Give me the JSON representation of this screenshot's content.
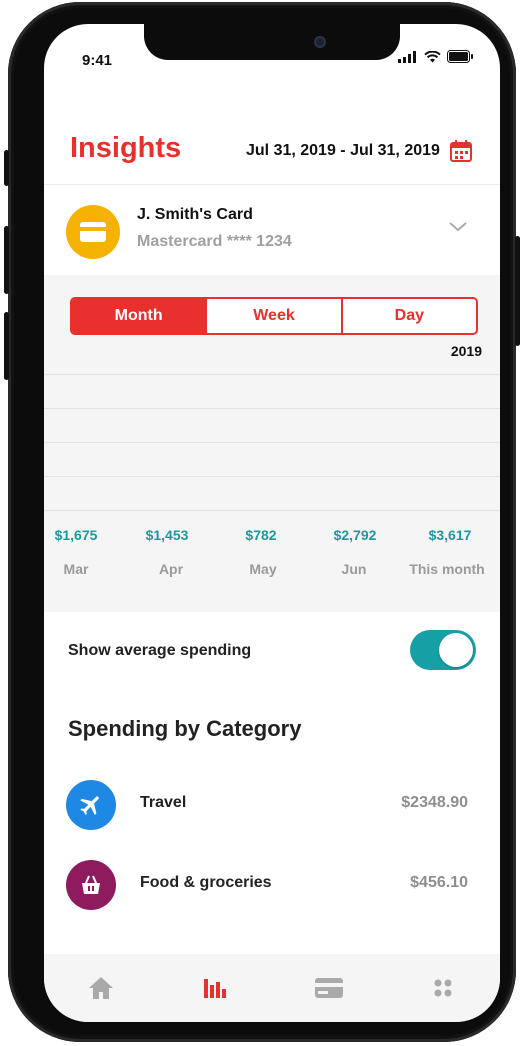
{
  "status_bar": {
    "time": "9:41"
  },
  "header": {
    "title": "Insights",
    "date_range": "Jul 31, 2019 - Jul 31, 2019",
    "calendar_icon": "calendar-icon"
  },
  "card": {
    "name": "J. Smith's Card",
    "subtitle": "Mastercard **** 1234",
    "icon": "credit-card-icon",
    "expand_icon": "chevron-down-icon"
  },
  "period_tabs": [
    {
      "label": "Month",
      "active": true
    },
    {
      "label": "Week",
      "active": false
    },
    {
      "label": "Day",
      "active": false
    }
  ],
  "chart": {
    "year": "2019",
    "columns": [
      {
        "amount": "$1,675",
        "label": "Mar"
      },
      {
        "amount": "$1,453",
        "label": "Apr"
      },
      {
        "amount": "$782",
        "label": "May"
      },
      {
        "amount": "$2,792",
        "label": "Jun"
      },
      {
        "amount": "$3,617",
        "label": "This month"
      }
    ]
  },
  "average_toggle": {
    "label": "Show average spending",
    "on": true
  },
  "categories": {
    "title": "Spending by Category",
    "items": [
      {
        "label": "Travel",
        "value": "$2348.90",
        "icon": "airplane-icon",
        "color": "#1e88e5"
      },
      {
        "label": "Food & groceries",
        "value": "$456.10",
        "icon": "shopping-basket-icon",
        "color": "#8e1b5e"
      }
    ]
  },
  "bottom_nav": [
    {
      "icon": "home-icon",
      "active": false
    },
    {
      "icon": "bar-chart-icon",
      "active": true
    },
    {
      "icon": "card-icon",
      "active": false
    },
    {
      "icon": "more-grid-icon",
      "active": false
    }
  ],
  "colors": {
    "accent": "#e8312d",
    "teal": "#16a0a6",
    "card_yellow": "#f5b200"
  }
}
